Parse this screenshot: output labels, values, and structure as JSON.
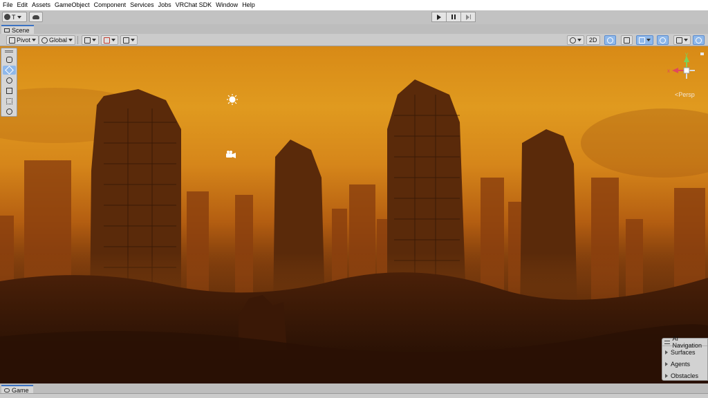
{
  "menu": [
    "File",
    "Edit",
    "Assets",
    "GameObject",
    "Component",
    "Services",
    "Jobs",
    "VRChat SDK",
    "Window",
    "Help"
  ],
  "toolbar": {
    "account_label": "T",
    "account_icon": "account-icon",
    "cloud_icon": "cloud-icon",
    "play_icon": "play-icon",
    "pause_icon": "pause-icon",
    "step_icon": "step-icon"
  },
  "scene_tab": {
    "label": "Scene",
    "icon": "scene-icon"
  },
  "scene_toolbar": {
    "pivot_label": "Pivot",
    "global_label": "Global",
    "mode_2d": "2D",
    "accent_color": "#8fb8ea"
  },
  "tools": [
    "hand-tool",
    "move-tool",
    "rotate-tool",
    "scale-tool",
    "rect-tool",
    "transform-tool"
  ],
  "gizmo": {
    "persp_label": "Persp",
    "y_label": "y",
    "x_label": "x",
    "y_color": "#7ad35a",
    "x_color": "#e0495a"
  },
  "ai_navigation": {
    "title": "AI Navigation",
    "items": [
      "Surfaces",
      "Agents",
      "Obstacles"
    ]
  },
  "game_tab": {
    "label": "Game",
    "icon": "game-icon"
  }
}
